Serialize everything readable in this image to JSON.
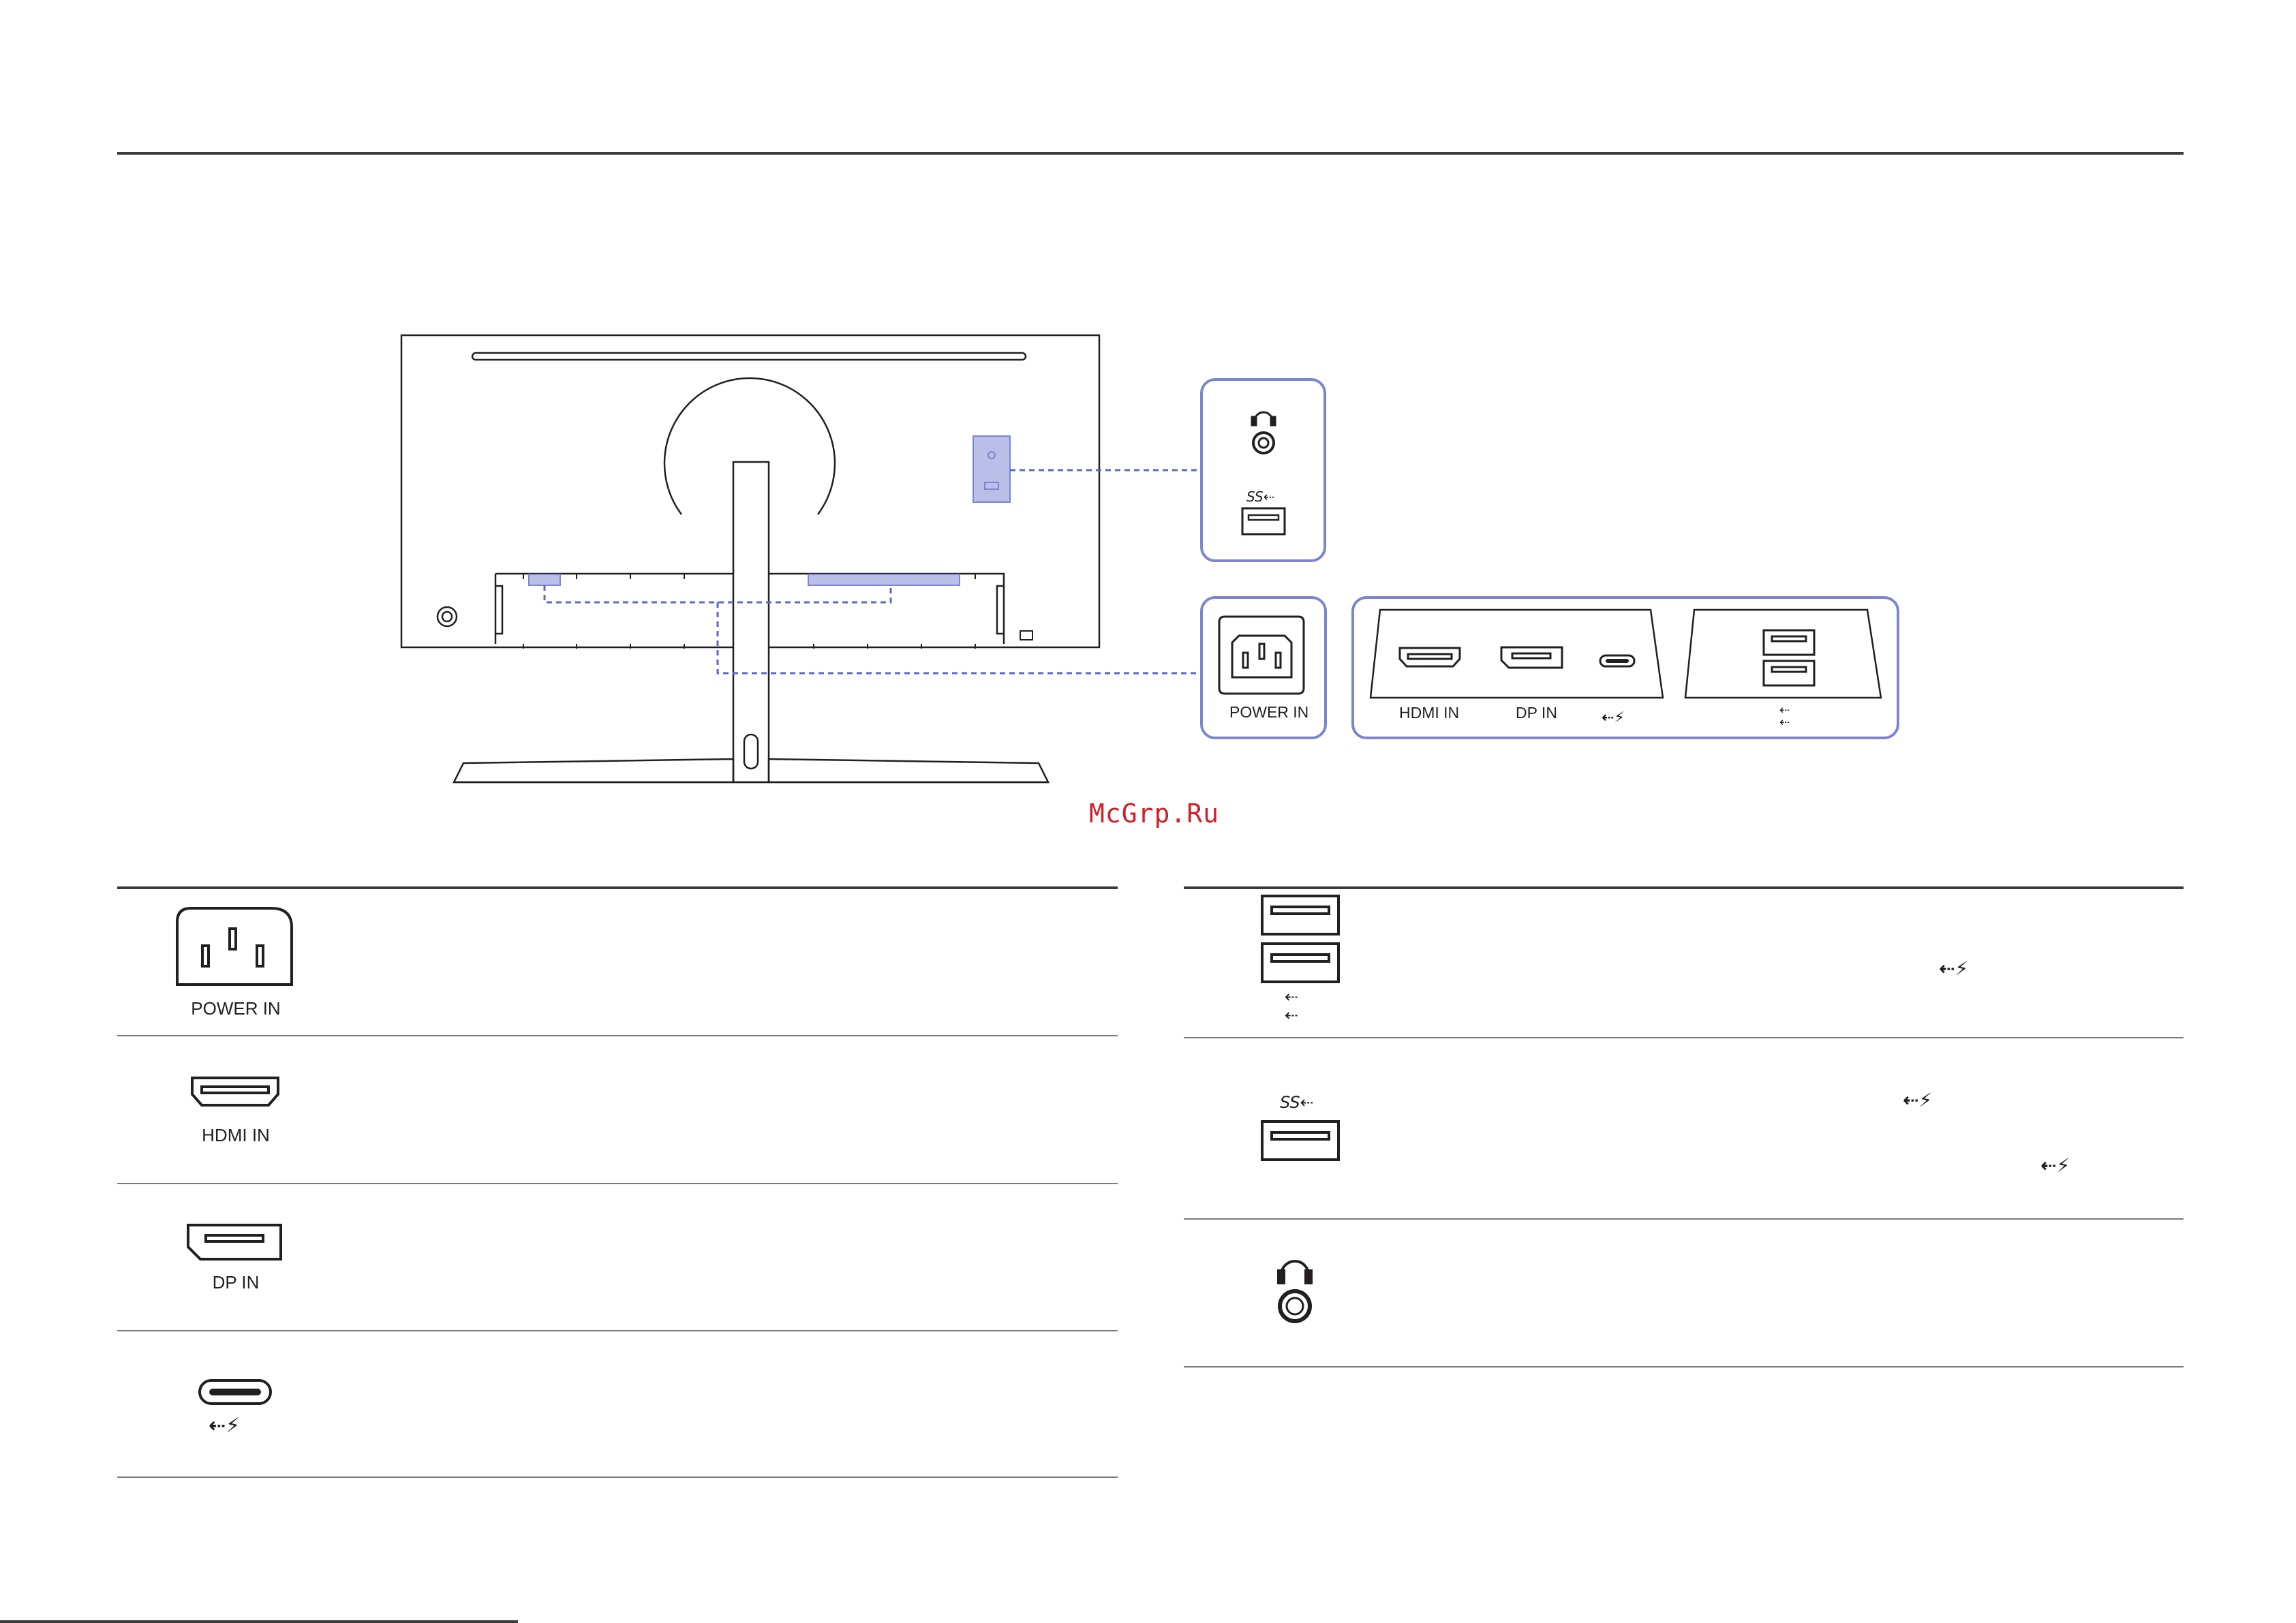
{
  "watermark": "McGrp.Ru",
  "diagram": {
    "labels": {
      "power": "POWER IN",
      "hdmi": "HDMI IN",
      "dp": "DP IN"
    },
    "icons": [
      "headphone-icon",
      "usb-superspeed-icon",
      "power-socket-icon",
      "hdmi-port-icon",
      "displayport-icon",
      "usb-c-port-icon",
      "usb-c-pd-icon",
      "usb-a-port-icon",
      "usb-icon"
    ]
  },
  "ports_left": [
    {
      "label": "POWER IN",
      "icon": "power-socket-icon"
    },
    {
      "label": "HDMI IN",
      "icon": "hdmi-port-icon"
    },
    {
      "label": "DP IN",
      "icon": "displayport-icon"
    },
    {
      "label": "",
      "icon": "usb-c-pd-icon"
    }
  ],
  "ports_right": [
    {
      "icon": "usb-a-hub-icon"
    },
    {
      "icon": "usb-superspeed-icon"
    },
    {
      "icon": "headphone-icon"
    }
  ],
  "colors": {
    "accent": "#7b86cf",
    "highlight": "#b9bfe6",
    "line": "#231f20",
    "watermark": "#d0202a"
  }
}
